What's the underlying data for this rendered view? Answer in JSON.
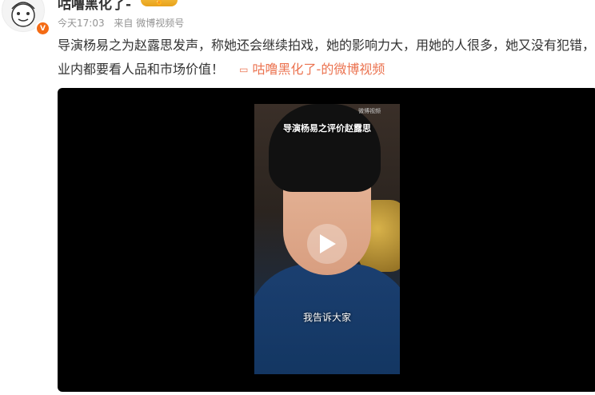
{
  "user": {
    "name": "咕噜黑化了-",
    "rank_badge": "🏅",
    "verified_badge": "V"
  },
  "meta": {
    "time": "今天17:03",
    "source": "来自 微博视频号"
  },
  "post": {
    "text": "导演杨易之为赵露思发声，称她还会继续拍戏，她的影响力大，用她的人很多，她又没有犯错，业内都要看人品和市场价值！",
    "link_text": "咕噜黑化了-的微博视频"
  },
  "video": {
    "overlay_title": "导演杨易之评价赵露思",
    "subtitle": "我告诉大家",
    "watermark": "微博视频"
  },
  "colors": {
    "link": "#eb7350",
    "verified": "#f46b14",
    "meta_text": "#939393"
  }
}
